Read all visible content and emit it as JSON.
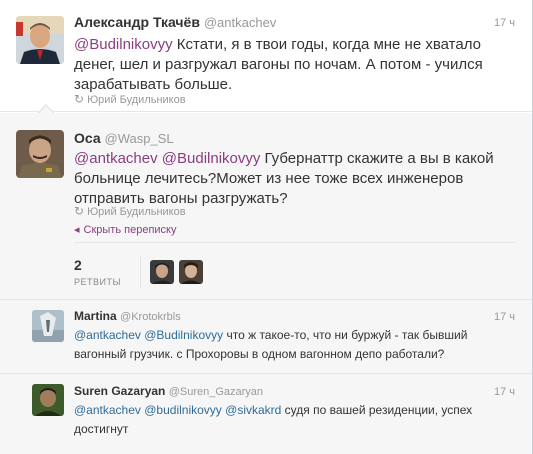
{
  "tweets": [
    {
      "name": "Александр Ткачёв",
      "handle": "@antkachev",
      "time": "17 ч",
      "mention1": "@Budilnikovyy",
      "text": " Кстати, я в твои годы, когда мне не хватало денег, шел и разгружал вагоны по ночам. А потом - учился зарабатывать больше.",
      "retweeted_by": "Юрий Будильников"
    },
    {
      "name": "Оса",
      "handle": "@Wasp_SL",
      "mention1": "@antkachev",
      "mention2": "@Budilnikovyy",
      "text": " Губернаттр скажите а вы в какой больнице лечитесь?Может из нее тоже всех инженеров отправить вагоны разгружать?",
      "retweeted_by": "Юрий Будильников",
      "hide_label": "Скрыть переписку",
      "retweet_count": "2",
      "retweet_label": "РЕТВИТЫ"
    }
  ],
  "replies": [
    {
      "name": "Martina",
      "handle": "@Krotokrbls",
      "time": "17 ч",
      "mention1": "@antkachev",
      "mention2": "@Budilnikovyy",
      "text": " что ж такое-то, что ни буржуй - так бывший вагонный грузчик. с Прохоровы в одном вагонном депо работали?"
    },
    {
      "name": "Suren Gazaryan",
      "handle": "@Suren_Gazaryan",
      "time": "17 ч",
      "mention1": "@antkachev",
      "mention2": "@budilnikovyy",
      "mention3": "@sivkakrd",
      "text": " судя по вашей резиденции, успех достигнут"
    }
  ],
  "icons": {
    "retweet": "↻",
    "hide": "◂"
  },
  "colors": {
    "mention": "#8a3e80",
    "mention_alt": "#2f6c99",
    "meta": "#999999",
    "text": "#333333",
    "background": "#f6f6f6"
  }
}
